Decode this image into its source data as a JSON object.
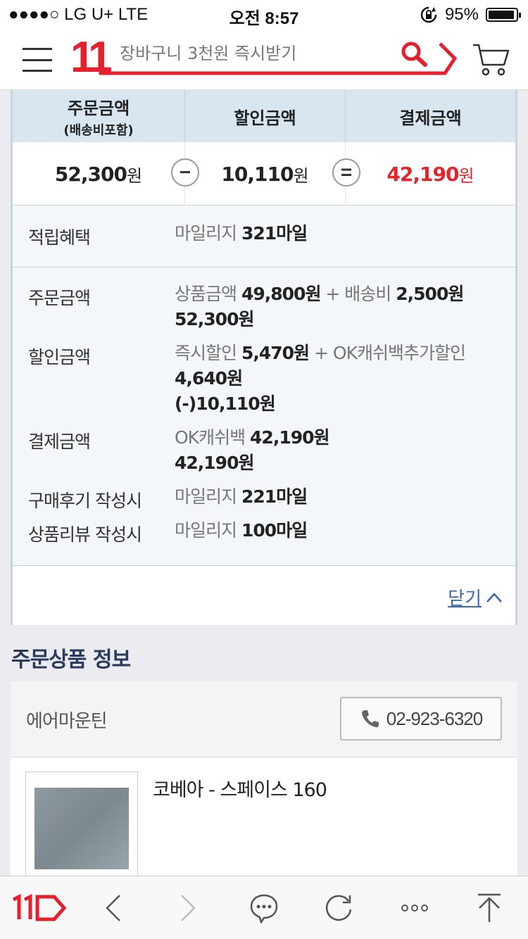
{
  "status_bar": {
    "carrier": "●●●●○ LG U+  LTE",
    "time": "오전 8:57",
    "battery": "95%",
    "battery_level": 0.95
  },
  "header": {
    "logo": "11",
    "search_placeholder": "장바구니 3천원 즉시받기"
  },
  "summary": {
    "headers": {
      "order": "주문금액",
      "order_sub": "(배송비포함)",
      "discount": "할인금액",
      "payment": "결제금액"
    },
    "values": {
      "order": "52,300",
      "discount": "10,110",
      "payment": "42,190",
      "won": "원"
    },
    "operators": {
      "minus": "−",
      "equals": "="
    },
    "accent_color": "#e3242b"
  },
  "benefit": {
    "label": "적립혜택",
    "prefix": "마일리지",
    "value": "321마일"
  },
  "details": {
    "order": {
      "label": "주문금액",
      "p1": "상품금액",
      "v1": "49,800원",
      "plus": " + ",
      "p2": "배송비",
      "v2": "2,500원",
      "total": "52,300원"
    },
    "discount": {
      "label": "할인금액",
      "p1": "즉시할인",
      "v1": "5,470원",
      "plus": " + ",
      "p2": "OK캐쉬백추가할인",
      "v2": "4,640원",
      "total": "(-)10,110원"
    },
    "payment": {
      "label": "결제금액",
      "p1": "OK캐쉬백",
      "v1": "42,190원",
      "total": "42,190원"
    },
    "review": {
      "label": "구매후기 작성시",
      "prefix": "마일리지",
      "value": "221마일"
    },
    "product_review": {
      "label": "상품리뷰 작성시",
      "prefix": "마일리지",
      "value": "100마일"
    }
  },
  "close": {
    "label": "닫기"
  },
  "order_products": {
    "title": "주문상품 정보",
    "seller": "에어마운틴",
    "phone": "02-923-6320",
    "product_name": "코베아 - 스페이스 160"
  },
  "toolbar": {
    "icons": [
      "11st-home-icon",
      "back-icon",
      "forward-icon",
      "chat-icon",
      "refresh-icon",
      "more-icon",
      "scroll-top-icon"
    ]
  }
}
